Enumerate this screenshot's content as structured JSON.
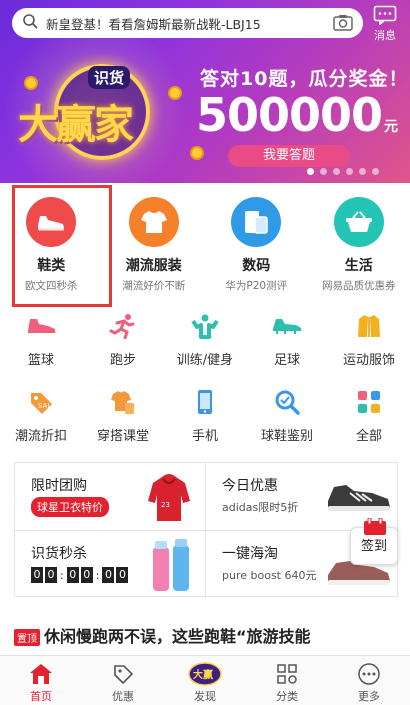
{
  "search": {
    "placeholder": "新皇登基！看看詹姆斯最新战靴-LBJ15"
  },
  "header": {
    "message_label": "消息"
  },
  "banner": {
    "logo_small": "识货",
    "logo_big": "大赢家",
    "headline": "答对10题，瓜分奖金！",
    "amount": "500000",
    "unit": "元",
    "cta": "我要答题"
  },
  "categories": [
    {
      "name": "鞋类",
      "sub": "欧文四秒杀",
      "icon": "sneaker-icon",
      "color": "#ef4b4b"
    },
    {
      "name": "潮流服装",
      "sub": "潮流好价不断",
      "icon": "tshirt-icon",
      "color": "#f5822b"
    },
    {
      "name": "数码",
      "sub": "华为P20测评",
      "icon": "phone-icon",
      "color": "#2f9be8"
    },
    {
      "name": "生活",
      "sub": "网易品质优惠券",
      "icon": "basket-icon",
      "color": "#24c4b4"
    }
  ],
  "grid": [
    {
      "label": "篮球",
      "icon": "basketball-shoe-icon"
    },
    {
      "label": "跑步",
      "icon": "runner-icon"
    },
    {
      "label": "训练/健身",
      "icon": "fitness-icon"
    },
    {
      "label": "足球",
      "icon": "football-boot-icon"
    },
    {
      "label": "运动服饰",
      "icon": "jacket-icon"
    },
    {
      "label": "潮流折扣",
      "icon": "tag-icon"
    },
    {
      "label": "穿搭课堂",
      "icon": "outfit-icon"
    },
    {
      "label": "手机",
      "icon": "mobile-icon"
    },
    {
      "label": "球鞋鉴别",
      "icon": "magnifier-icon"
    },
    {
      "label": "全部",
      "icon": "all-apps-icon"
    }
  ],
  "promos": {
    "group_buy": {
      "title": "限时团购",
      "tag": "球星卫衣特价"
    },
    "today": {
      "title": "今日优惠",
      "sub": "adidas限时5折"
    },
    "flash": {
      "title": "识货秒杀",
      "timer": [
        "0",
        "0",
        "0",
        "0",
        "0",
        "0"
      ]
    },
    "haitao": {
      "title": "一键海淘",
      "sub": "pure boost 640元"
    }
  },
  "checkin": {
    "label": "签到"
  },
  "article": {
    "tag": "置顶",
    "title": "休闲慢跑两不误，这些跑鞋“旅游技能"
  },
  "tabs": [
    {
      "label": "首页",
      "icon": "home-icon"
    },
    {
      "label": "优惠",
      "icon": "coupon-icon"
    },
    {
      "label": "发现",
      "icon": "discover-icon"
    },
    {
      "label": "分类",
      "icon": "category-icon"
    },
    {
      "label": "更多",
      "icon": "more-icon"
    }
  ]
}
